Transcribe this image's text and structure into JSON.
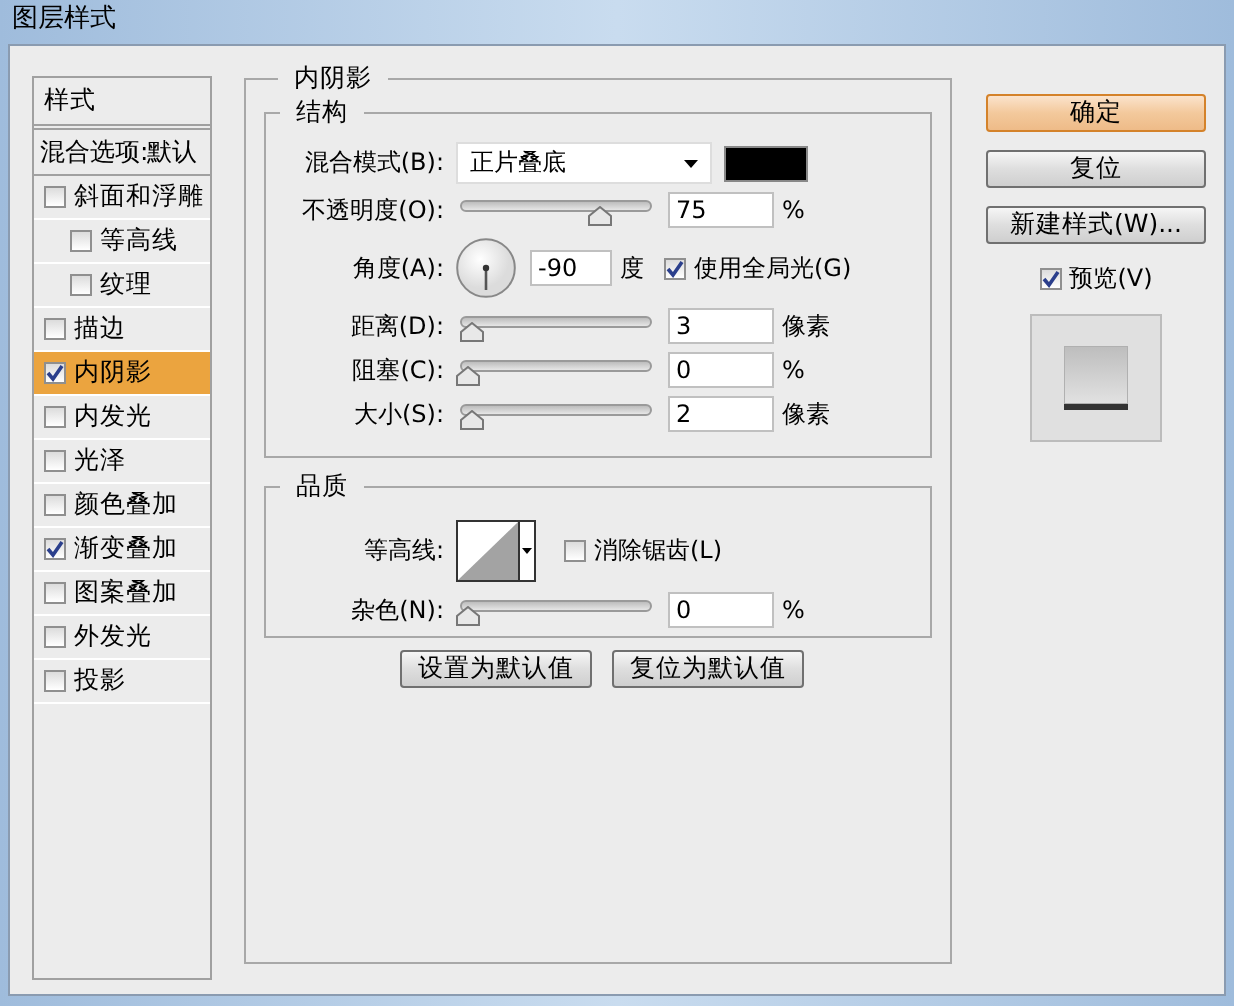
{
  "window": {
    "title": "图层样式"
  },
  "styles_panel": {
    "header": "样式",
    "blend_options": "混合选项:默认",
    "items": [
      {
        "label": "斜面和浮雕",
        "checked": false,
        "selected": false,
        "children": [
          {
            "label": "等高线",
            "checked": false,
            "selected": false
          },
          {
            "label": "纹理",
            "checked": false,
            "selected": false
          }
        ]
      },
      {
        "label": "描边",
        "checked": false,
        "selected": false
      },
      {
        "label": "内阴影",
        "checked": true,
        "selected": true
      },
      {
        "label": "内发光",
        "checked": false,
        "selected": false
      },
      {
        "label": "光泽",
        "checked": false,
        "selected": false
      },
      {
        "label": "颜色叠加",
        "checked": false,
        "selected": false
      },
      {
        "label": "渐变叠加",
        "checked": true,
        "selected": false
      },
      {
        "label": "图案叠加",
        "checked": false,
        "selected": false
      },
      {
        "label": "外发光",
        "checked": false,
        "selected": false
      },
      {
        "label": "投影",
        "checked": false,
        "selected": false
      }
    ]
  },
  "inner_shadow": {
    "title": "内阴影",
    "structure": {
      "title": "结构",
      "rows": [
        {
          "kind": "dropdown",
          "label": "混合模式(B):",
          "value": "正片叠底",
          "color": "#000000"
        },
        {
          "kind": "slider",
          "label": "不透明度(O):",
          "level": 0.75,
          "value": "75",
          "unit": "%"
        },
        {
          "kind": "angle",
          "label": "角度(A):",
          "value": "-90",
          "unit": "度",
          "global_light": {
            "label": "使用全局光(G)",
            "checked": true
          }
        },
        {
          "kind": "slider",
          "label": "距离(D):",
          "level": 0.02,
          "value": "3",
          "unit": "像素"
        },
        {
          "kind": "slider",
          "label": "阻塞(C):",
          "level": 0,
          "value": "0",
          "unit": "%"
        },
        {
          "kind": "slider",
          "label": "大小(S):",
          "level": 0.02,
          "value": "2",
          "unit": "像素"
        }
      ]
    },
    "quality": {
      "title": "品质",
      "rows": [
        {
          "kind": "contour",
          "label": "等高线:",
          "anti_alias": {
            "label": "消除锯齿(L)",
            "checked": false
          }
        },
        {
          "kind": "slider",
          "label": "杂色(N):",
          "level": 0,
          "value": "0",
          "unit": "%"
        }
      ]
    },
    "buttons": [
      "设置为默认值",
      "复位为默认值"
    ]
  },
  "actions": [
    {
      "label": "确定",
      "default": true
    },
    {
      "label": "复位",
      "default": false
    },
    {
      "label": "新建样式(W)...",
      "default": false
    }
  ],
  "preview": {
    "label": "预览(V)",
    "checked": true
  }
}
